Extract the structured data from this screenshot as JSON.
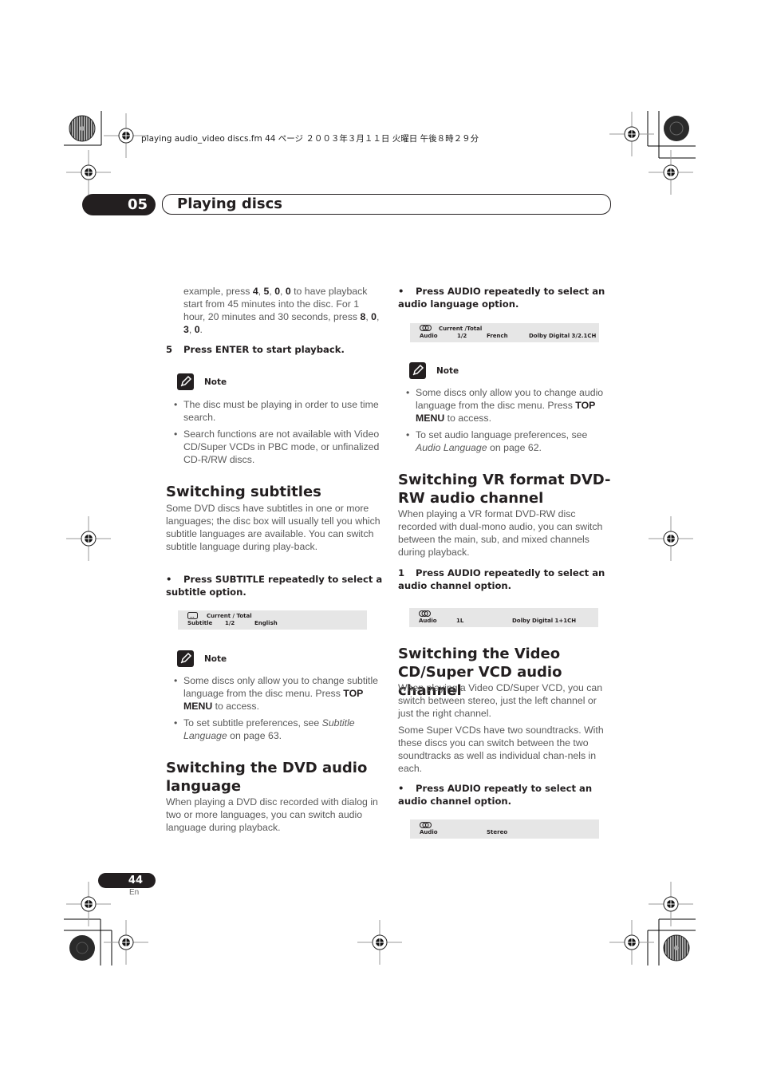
{
  "print_header": {
    "file_info": "playing audio_video discs.fm  44 ページ  ２００３年３月１１日  火曜日  午後８時２９分"
  },
  "chapter": {
    "number": "05",
    "title": "Playing discs"
  },
  "left_column": {
    "intro_text_html": "example, press <b>4</b>, <b>5</b>, <b>0</b>, <b>0</b> to have playback start from 45 minutes into the disc. For 1 hour, 20 minutes and 30 seconds, press <b>8</b>, <b>0</b>, <b>3</b>, <b>0</b>.",
    "step5": {
      "number": "5",
      "text": "Press ENTER to start playback."
    },
    "note1": {
      "label": "Note",
      "items": [
        "The disc must be playing in order to use time search.",
        "Search functions are not available with Video CD/Super VCDs in PBC mode, or unfinalized  CD-R/RW discs."
      ]
    },
    "subtitles": {
      "heading": "Switching subtitles",
      "body": "Some DVD discs have subtitles in one or more languages; the disc box will usually tell you which subtitle languages are available. You can switch subtitle language during play-back.",
      "instruction_bullet": "•",
      "instruction": "Press SUBTITLE repeatedly to select a subtitle option.",
      "osd": {
        "icon": "subtitle-icon",
        "header": "Current / Total",
        "label": "Subtitle",
        "value": "1/2",
        "language": "English"
      }
    },
    "note2": {
      "label": "Note",
      "items_html": [
        "Some discs only allow you to change subtitle language from the disc menu. Press <b>TOP MENU</b> to access.",
        "To set subtitle preferences, see <i>Subtitle Language</i> on page 63."
      ]
    },
    "dvd_audio": {
      "heading": "Switching the DVD audio language",
      "body": "When playing a DVD disc recorded with dialog in two or more languages, you can switch audio language during playback."
    }
  },
  "right_column": {
    "audio_instruction_bullet": "•",
    "audio_instruction": "Press AUDIO repeatedly to select an audio language option.",
    "osd_audio_lang": {
      "icon": "audio-icon",
      "header": "Current /Total",
      "label": "Audio",
      "value": "1/2",
      "language": "French",
      "format": "Dolby Digital 3/2.1CH"
    },
    "note3": {
      "label": "Note",
      "items_html": [
        "Some discs only allow you to change audio language from the disc menu. Press <b>TOP MENU</b> to access.",
        "To set audio language preferences, see <i>Audio Language</i> on page 62."
      ]
    },
    "vr_format": {
      "heading": "Switching VR format DVD-RW audio channel",
      "body": "When playing a VR format DVD-RW disc recorded with dual-mono audio, you can switch between the main, sub, and mixed channels during playback.",
      "step_number": "1",
      "step": "Press AUDIO repeatedly to select an audio channel option.",
      "osd": {
        "icon": "audio-icon",
        "label": "Audio",
        "channel": "1L",
        "format": "Dolby Digital 1+1CH"
      }
    },
    "vcd": {
      "heading": "Switching the Video CD/Super VCD audio channel",
      "body1": "When playing a Video CD/Super VCD, you can switch between stereo, just the left channel or just the right channel.",
      "body2": "Some Super VCDs have two soundtracks. With these discs you can switch between the two soundtracks as well as individual chan-nels in each.",
      "instruction_bullet": "•",
      "instruction": "Press AUDIO repeatly to select an audio channel option.",
      "osd": {
        "icon": "audio-icon",
        "label": "Audio",
        "mode": "Stereo"
      }
    }
  },
  "footer": {
    "page_number": "44",
    "language": "En"
  }
}
